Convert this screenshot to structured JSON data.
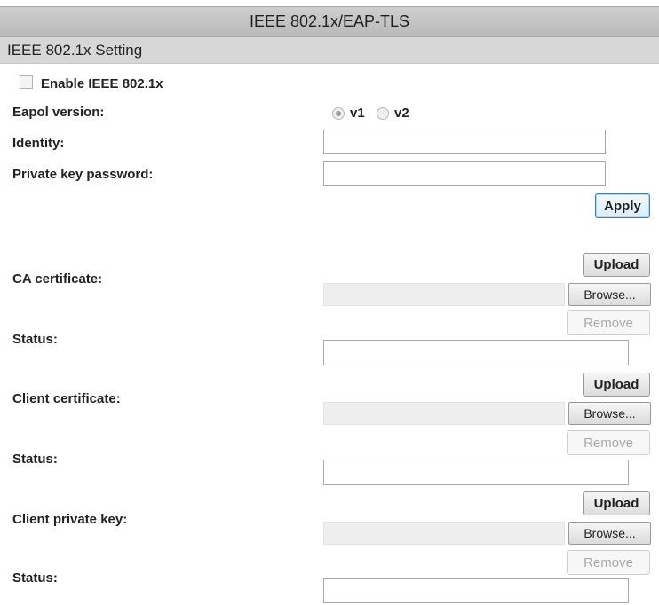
{
  "title": "IEEE 802.1x/EAP-TLS",
  "section": "IEEE 802.1x Setting",
  "enable": {
    "label": "Enable IEEE 802.1x",
    "checked": false
  },
  "eapol": {
    "label": "Eapol version:",
    "options": [
      "v1",
      "v2"
    ],
    "selected": "v1"
  },
  "identity": {
    "label": "Identity:",
    "value": ""
  },
  "private_key_password": {
    "label": "Private key password:",
    "value": ""
  },
  "apply_label": "Apply",
  "certificates": [
    {
      "label": "CA certificate:",
      "upload": "Upload",
      "browse": "Browse...",
      "remove": "Remove",
      "status_label": "Status:",
      "status_value": ""
    },
    {
      "label": "Client certificate:",
      "upload": "Upload",
      "browse": "Browse...",
      "remove": "Remove",
      "status_label": "Status:",
      "status_value": ""
    },
    {
      "label": "Client private key:",
      "upload": "Upload",
      "browse": "Browse...",
      "remove": "Remove",
      "status_label": "Status:",
      "status_value": ""
    }
  ]
}
